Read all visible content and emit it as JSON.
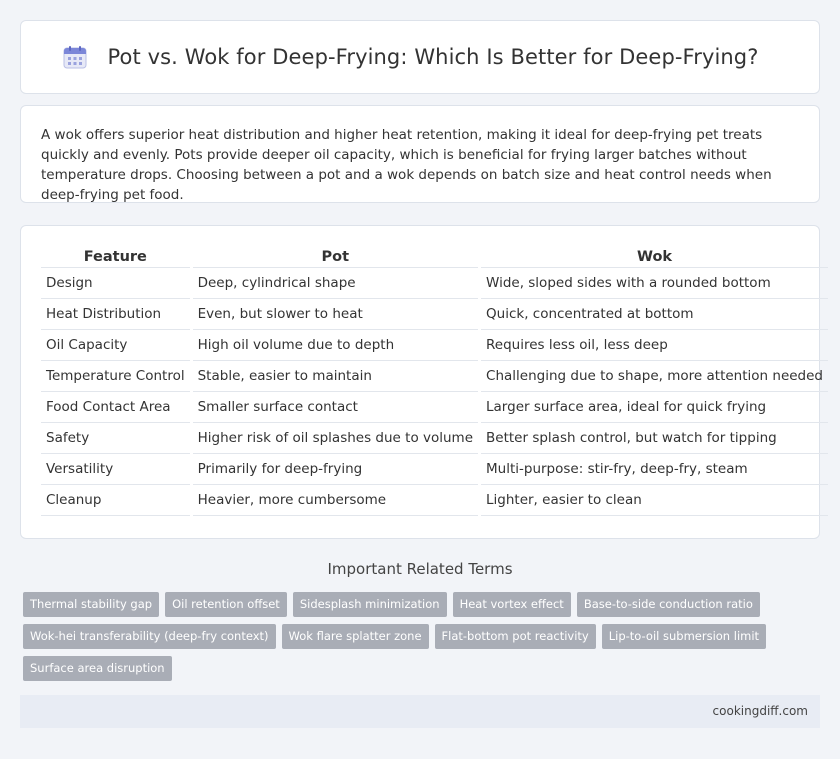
{
  "title": "Pot vs. Wok for Deep-Frying: Which Is Better for Deep-Frying?",
  "summary": "A wok offers superior heat distribution and higher heat retention, making it ideal for deep-frying pet treats quickly and evenly. Pots provide deeper oil capacity, which is beneficial for frying larger batches without temperature drops. Choosing between a pot and a wok depends on batch size and heat control needs when deep-frying pet food.",
  "table": {
    "headers": [
      "Feature",
      "Pot",
      "Wok"
    ],
    "rows": [
      [
        "Design",
        "Deep, cylindrical shape",
        "Wide, sloped sides with a rounded bottom"
      ],
      [
        "Heat Distribution",
        "Even, but slower to heat",
        "Quick, concentrated at bottom"
      ],
      [
        "Oil Capacity",
        "High oil volume due to depth",
        "Requires less oil, less deep"
      ],
      [
        "Temperature Control",
        "Stable, easier to maintain",
        "Challenging due to shape, more attention needed"
      ],
      [
        "Food Contact Area",
        "Smaller surface contact",
        "Larger surface area, ideal for quick frying"
      ],
      [
        "Safety",
        "Higher risk of oil splashes due to volume",
        "Better splash control, but watch for tipping"
      ],
      [
        "Versatility",
        "Primarily for deep-frying",
        "Multi-purpose: stir-fry, deep-fry, steam"
      ],
      [
        "Cleanup",
        "Heavier, more cumbersome",
        "Lighter, easier to clean"
      ]
    ]
  },
  "related": {
    "title": "Important Related Terms",
    "tags": [
      "Thermal stability gap",
      "Oil retention offset",
      "Sidesplash minimization",
      "Heat vortex effect",
      "Base-to-side conduction ratio",
      "Wok-hei transferability (deep-fry context)",
      "Wok flare splatter zone",
      "Flat-bottom pot reactivity",
      "Lip-to-oil submersion limit",
      "Surface area disruption"
    ]
  },
  "footer": "cookingdiff.com",
  "icons": {
    "title_icon": "calendar-icon"
  },
  "colors": {
    "tag_bg": "#a9adb6",
    "footer_bg": "#e8ecf4",
    "page_bg": "#f2f4f8"
  }
}
